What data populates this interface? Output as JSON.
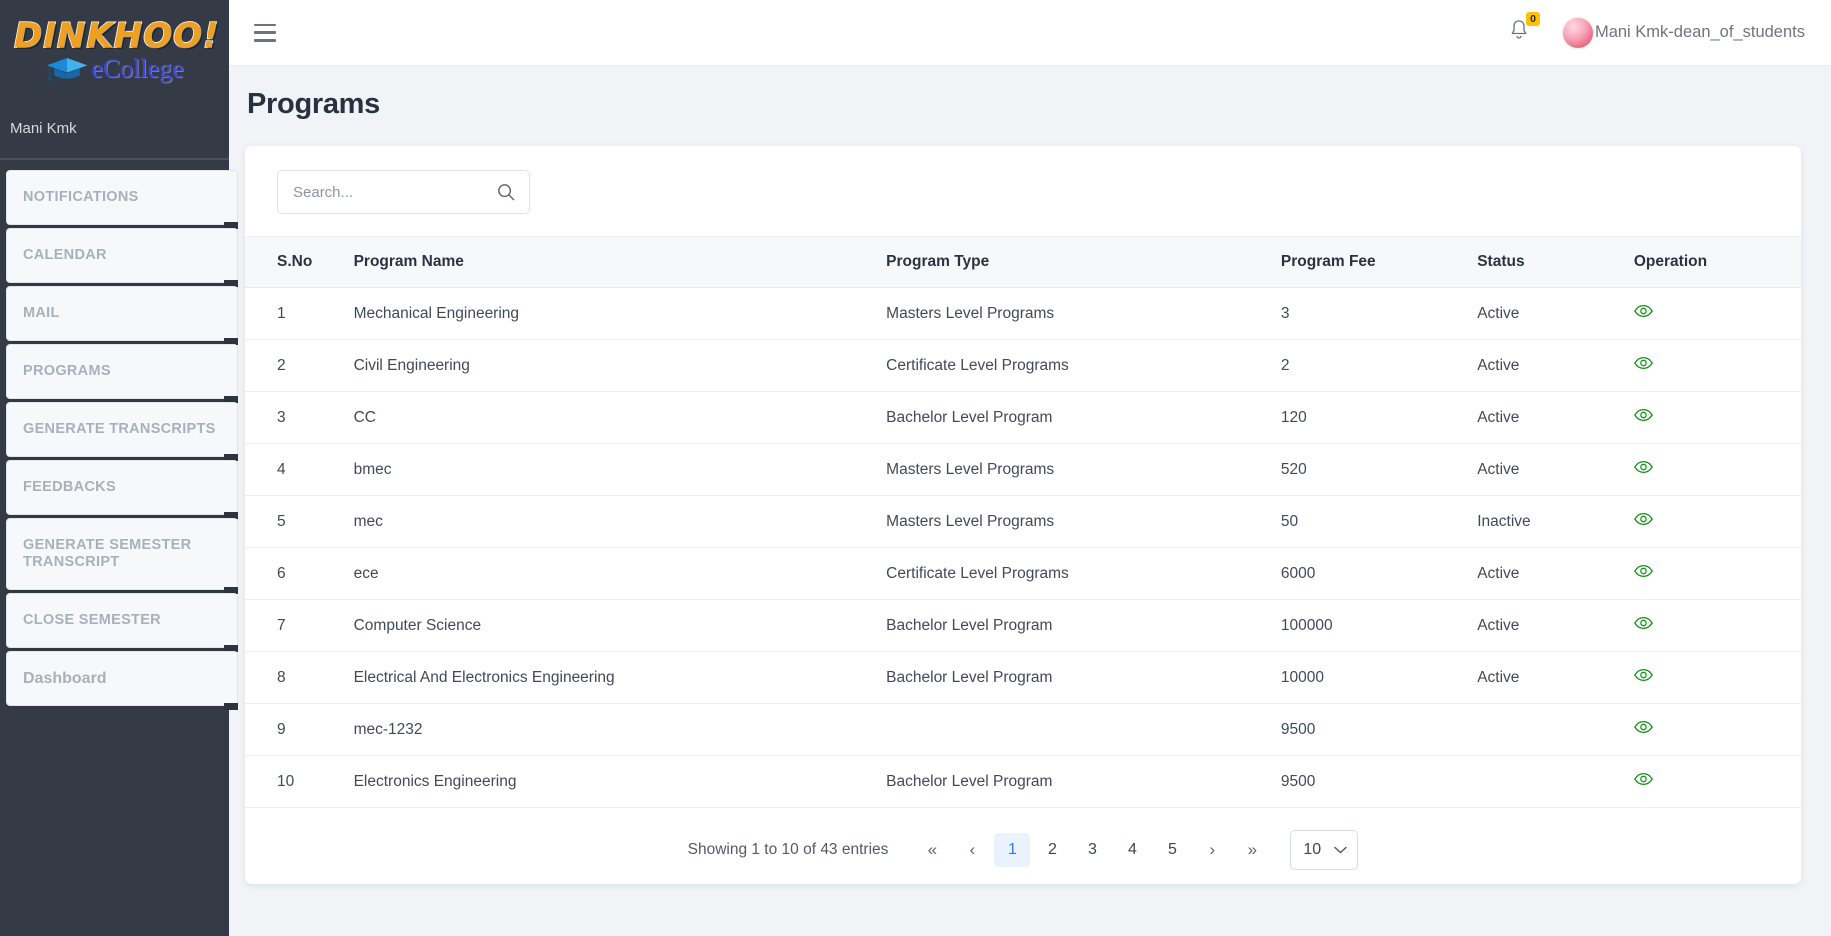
{
  "sidebar": {
    "logo_main": "DINKHOO!",
    "logo_sub": "eCollege",
    "user": "Mani Kmk",
    "items": [
      {
        "label": "NOTIFICATIONS"
      },
      {
        "label": "CALENDAR"
      },
      {
        "label": "MAIL"
      },
      {
        "label": "PROGRAMS"
      },
      {
        "label": "GENERATE TRANSCRIPTS"
      },
      {
        "label": "FEEDBACKS"
      },
      {
        "label": "GENERATE SEMESTER TRANSCRIPT"
      },
      {
        "label": "CLOSE SEMESTER"
      },
      {
        "label": "Dashboard"
      }
    ]
  },
  "header": {
    "notification_count": "0",
    "user_label": "Mani Kmk-dean_of_students"
  },
  "page": {
    "title": "Programs"
  },
  "search": {
    "placeholder": "Search...",
    "value": ""
  },
  "table": {
    "columns": [
      "S.No",
      "Program Name",
      "Program Type",
      "Program Fee",
      "Status",
      "Operation"
    ],
    "rows": [
      {
        "sno": "1",
        "name": "Mechanical Engineering",
        "type": "Masters Level Programs",
        "fee": "3",
        "status": "Active"
      },
      {
        "sno": "2",
        "name": "Civil Engineering",
        "type": "Certificate Level Programs",
        "fee": "2",
        "status": "Active"
      },
      {
        "sno": "3",
        "name": "CC",
        "type": "Bachelor Level Program",
        "fee": "120",
        "status": "Active"
      },
      {
        "sno": "4",
        "name": "bmec",
        "type": "Masters Level Programs",
        "fee": "520",
        "status": "Active"
      },
      {
        "sno": "5",
        "name": "mec",
        "type": "Masters Level Programs",
        "fee": "50",
        "status": "Inactive"
      },
      {
        "sno": "6",
        "name": "ece",
        "type": "Certificate Level Programs",
        "fee": "6000",
        "status": "Active"
      },
      {
        "sno": "7",
        "name": "Computer Science",
        "type": "Bachelor Level Program",
        "fee": "100000",
        "status": "Active"
      },
      {
        "sno": "8",
        "name": "Electrical And Electronics Engineering",
        "type": "Bachelor Level Program",
        "fee": "10000",
        "status": "Active"
      },
      {
        "sno": "9",
        "name": "mec-1232",
        "type": "",
        "fee": "9500",
        "status": ""
      },
      {
        "sno": "10",
        "name": "Electronics Engineering",
        "type": "Bachelor Level Program",
        "fee": "9500",
        "status": ""
      }
    ]
  },
  "pagination": {
    "info": "Showing 1 to 10 of 43 entries",
    "first": "«",
    "prev": "‹",
    "next": "›",
    "last": "»",
    "pages": [
      "1",
      "2",
      "3",
      "4",
      "5"
    ],
    "active_page": "1",
    "page_size": "10"
  },
  "colors": {
    "sidebar_bg": "#343a46",
    "accent_blue": "#2b7ef0",
    "eye_green": "#149414",
    "badge_yellow": "#ffc107",
    "logo_orange": "#f0a020"
  }
}
